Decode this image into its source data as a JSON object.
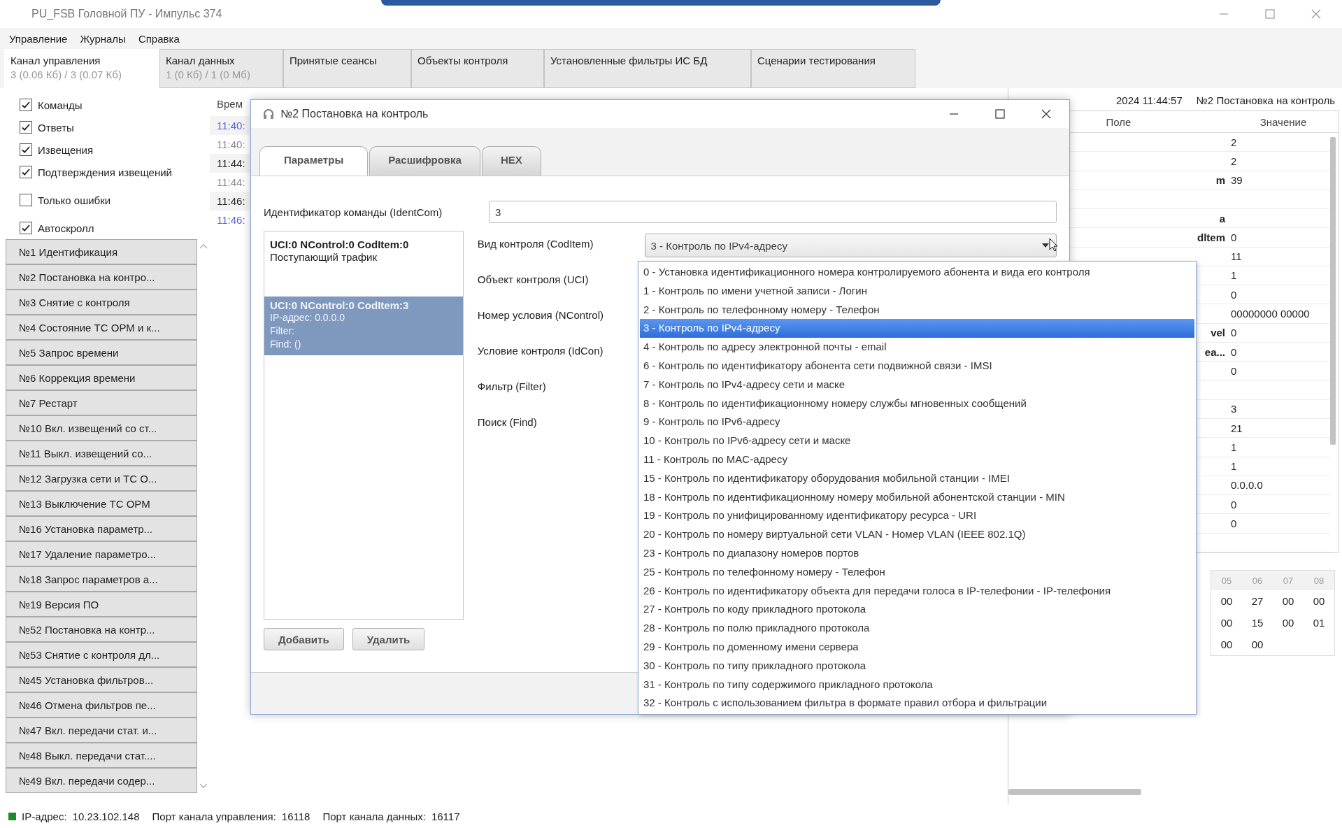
{
  "window": {
    "title": "PU_FSB Головной ПУ - Импульс 374"
  },
  "menu": [
    "Управление",
    "Журналы",
    "Справка"
  ],
  "tabs": [
    {
      "label": "Канал управления",
      "sub": "3 (0.06 Кб) / 3 (0.07 Кб)",
      "selected": true
    },
    {
      "label": "Канал данных",
      "sub": "1 (0 Кб) / 1 (0 Мб)",
      "selected": false
    },
    {
      "label": "Принятые сеансы",
      "selected": false
    },
    {
      "label": "Объекты контроля",
      "selected": false
    },
    {
      "label": "Установленные фильтры ИС БД",
      "selected": false
    },
    {
      "label": "Сценарии тестирования",
      "selected": false
    }
  ],
  "filters": [
    {
      "label": "Команды",
      "checked": true
    },
    {
      "label": "Ответы",
      "checked": true
    },
    {
      "label": "Извещения",
      "checked": true
    },
    {
      "label": "Подтверждения извещений",
      "checked": true
    },
    {
      "label": "Только ошибки",
      "checked": false
    },
    {
      "label": "Автоскролл",
      "checked": true
    }
  ],
  "commands": [
    "№1 Идентификация",
    "№2 Постановка на контро...",
    "№3 Снятие с контроля",
    "№4 Состояние ТС ОРМ и к...",
    "№5 Запрос времени",
    "№6 Коррекция времени",
    "№7 Рестарт",
    "№10 Вкл. извещений со ст...",
    "№11 Выкл. извещений со...",
    "№12 Загрузка сети и ТС О...",
    "№13 Выключение ТС ОРМ",
    "№16 Установка параметр...",
    "№17 Удаление параметро...",
    "№18 Запрос параметров а...",
    "№19 Версия ПО",
    "№52 Постановка на контр...",
    "№53 Снятие с контроля дл...",
    "№45 Установка фильтров...",
    "№46 Отмена фильтров пе...",
    "№47 Вкл. передачи стат. и...",
    "№48 Выкл. передачи стат....",
    "№49 Вкл. передачи содер..."
  ],
  "log": {
    "header": "Врем",
    "rows": [
      {
        "time": "11:40:",
        "kind": "incoming"
      },
      {
        "time": "11:40:",
        "kind": "reply"
      },
      {
        "time": "11:44:",
        "kind": "command"
      },
      {
        "time": "11:44:",
        "kind": "reply"
      },
      {
        "time": "11:46:",
        "kind": "command"
      },
      {
        "time": "11:46:",
        "kind": "incoming"
      }
    ]
  },
  "detail": {
    "caption": "2024 11:44:57",
    "command": "№2 Постановка на контроль",
    "columns": [
      "Поле",
      "Значение"
    ],
    "rows": [
      {
        "value": "2"
      },
      {
        "value": "2"
      },
      {
        "field": "m",
        "value": "39"
      },
      {},
      {
        "field": "a"
      },
      {
        "field": "dltem",
        "value": "0"
      },
      {
        "value": "11"
      },
      {
        "value": "1"
      },
      {
        "value": "0"
      },
      {
        "value": "00000000 00000"
      },
      {
        "field": "vel",
        "value": "0"
      },
      {
        "field": "ea...",
        "value": "0"
      },
      {
        "value": "0"
      },
      {},
      {
        "value": "3"
      },
      {
        "value": "21"
      },
      {
        "value": "1"
      },
      {
        "value": "1"
      },
      {
        "value": "0.0.0.0"
      },
      {
        "value": "0"
      },
      {
        "value": "0"
      },
      {}
    ],
    "hex": {
      "columns": [
        "05",
        "06",
        "07",
        "08"
      ],
      "rows": [
        [
          "00",
          "27",
          "00",
          "00"
        ],
        [
          "00",
          "15",
          "00",
          "01"
        ],
        [
          "00",
          "00"
        ]
      ]
    }
  },
  "dialog": {
    "title": "№2 Постановка на контроль",
    "tabs": [
      {
        "label": "Параметры",
        "selected": true
      },
      {
        "label": "Расшифровка",
        "selected": false
      },
      {
        "label": "HEX",
        "selected": false
      }
    ],
    "ident": {
      "label": "Идентификатор команды (IdentCom)",
      "value": "3"
    },
    "conditions": [
      {
        "header": "UCI:0  NControl:0  CodItem:0",
        "lines": [
          "Поступающий трафик"
        ],
        "selected": false
      },
      {
        "header": "UCI:0  NControl:0  CodItem:3",
        "lines": [
          "IP-адрес:  0.0.0.0",
          "Filter:",
          "Find:  ()"
        ],
        "selected": true
      }
    ],
    "fields": [
      "Вид контроля (CodItem)",
      "Объект контроля (UCI)",
      "Номер условия (NControl)",
      "Условие контроля (IdCon)",
      "Фильтр (Filter)",
      "Поиск (Find)"
    ],
    "combo": {
      "value": "3 - Контроль по IPv4-адресу",
      "expanded": true
    },
    "options": [
      {
        "label": "0 - Установка идентификационного номера контролируемого абонента и вида его контроля",
        "selected": false
      },
      {
        "label": "1 - Контроль по имени учетной записи - Логин",
        "selected": false
      },
      {
        "label": "2 - Контроль по телефонному номеру - Телефон",
        "selected": false
      },
      {
        "label": "3 - Контроль по IPv4-адресу",
        "selected": true
      },
      {
        "label": "4 - Контроль по адресу электронной почты - email",
        "selected": false
      },
      {
        "label": "6 - Контроль по идентификатору абонента сети подвижной связи - IMSI",
        "selected": false
      },
      {
        "label": "7 - Контроль по IPv4-адресу сети и маске",
        "selected": false
      },
      {
        "label": "8 - Контроль по идентификационному номеру службы мгновенных сообщений",
        "selected": false
      },
      {
        "label": "9 - Контроль по IPv6-адресу",
        "selected": false
      },
      {
        "label": "10 - Контроль по IPv6-адресу сети и маске",
        "selected": false
      },
      {
        "label": "11 - Контроль по MAC-адресу",
        "selected": false
      },
      {
        "label": "15 - Контроль по идентификатору оборудования мобильной станции - IMEI",
        "selected": false
      },
      {
        "label": "18 - Контроль по идентификационному номеру мобильной абонентской станции - MIN",
        "selected": false
      },
      {
        "label": "19 - Контроль по унифицированному идентификатору ресурса - URI",
        "selected": false
      },
      {
        "label": "20 - Контроль по номеру виртуальной сети VLAN - Номер VLAN (IEEE 802.1Q)",
        "selected": false
      },
      {
        "label": "23 - Контроль по диапазону номеров портов",
        "selected": false
      },
      {
        "label": "25 - Контроль по телефонному номеру - Телефон",
        "selected": false
      },
      {
        "label": "26 - Контроль по идентификатору объекта для передачи голоса в IP-телефонии - IP-телефония",
        "selected": false
      },
      {
        "label": "27 - Контроль по коду прикладного протокола",
        "selected": false
      },
      {
        "label": "28 - Контроль по полю прикладного протокола",
        "selected": false
      },
      {
        "label": "29 - Контроль по доменному имени сервера",
        "selected": false
      },
      {
        "label": "30 - Контроль по типу прикладного протокола",
        "selected": false
      },
      {
        "label": "31 - Контроль по типу содержимого прикладного протокола",
        "selected": false
      },
      {
        "label": "32 - Контроль с использованием фильтра в формате правил отбора и фильтрации",
        "selected": false
      }
    ],
    "buttons": [
      "Добавить",
      "Удалить"
    ]
  },
  "status": {
    "connected": true,
    "items": [
      {
        "label": "IP-адрес:",
        "value": "10.23.102.148"
      },
      {
        "label": "Порт канала управления:",
        "value": "16118"
      },
      {
        "label": "Порт канала данных:",
        "value": "16117"
      }
    ]
  }
}
